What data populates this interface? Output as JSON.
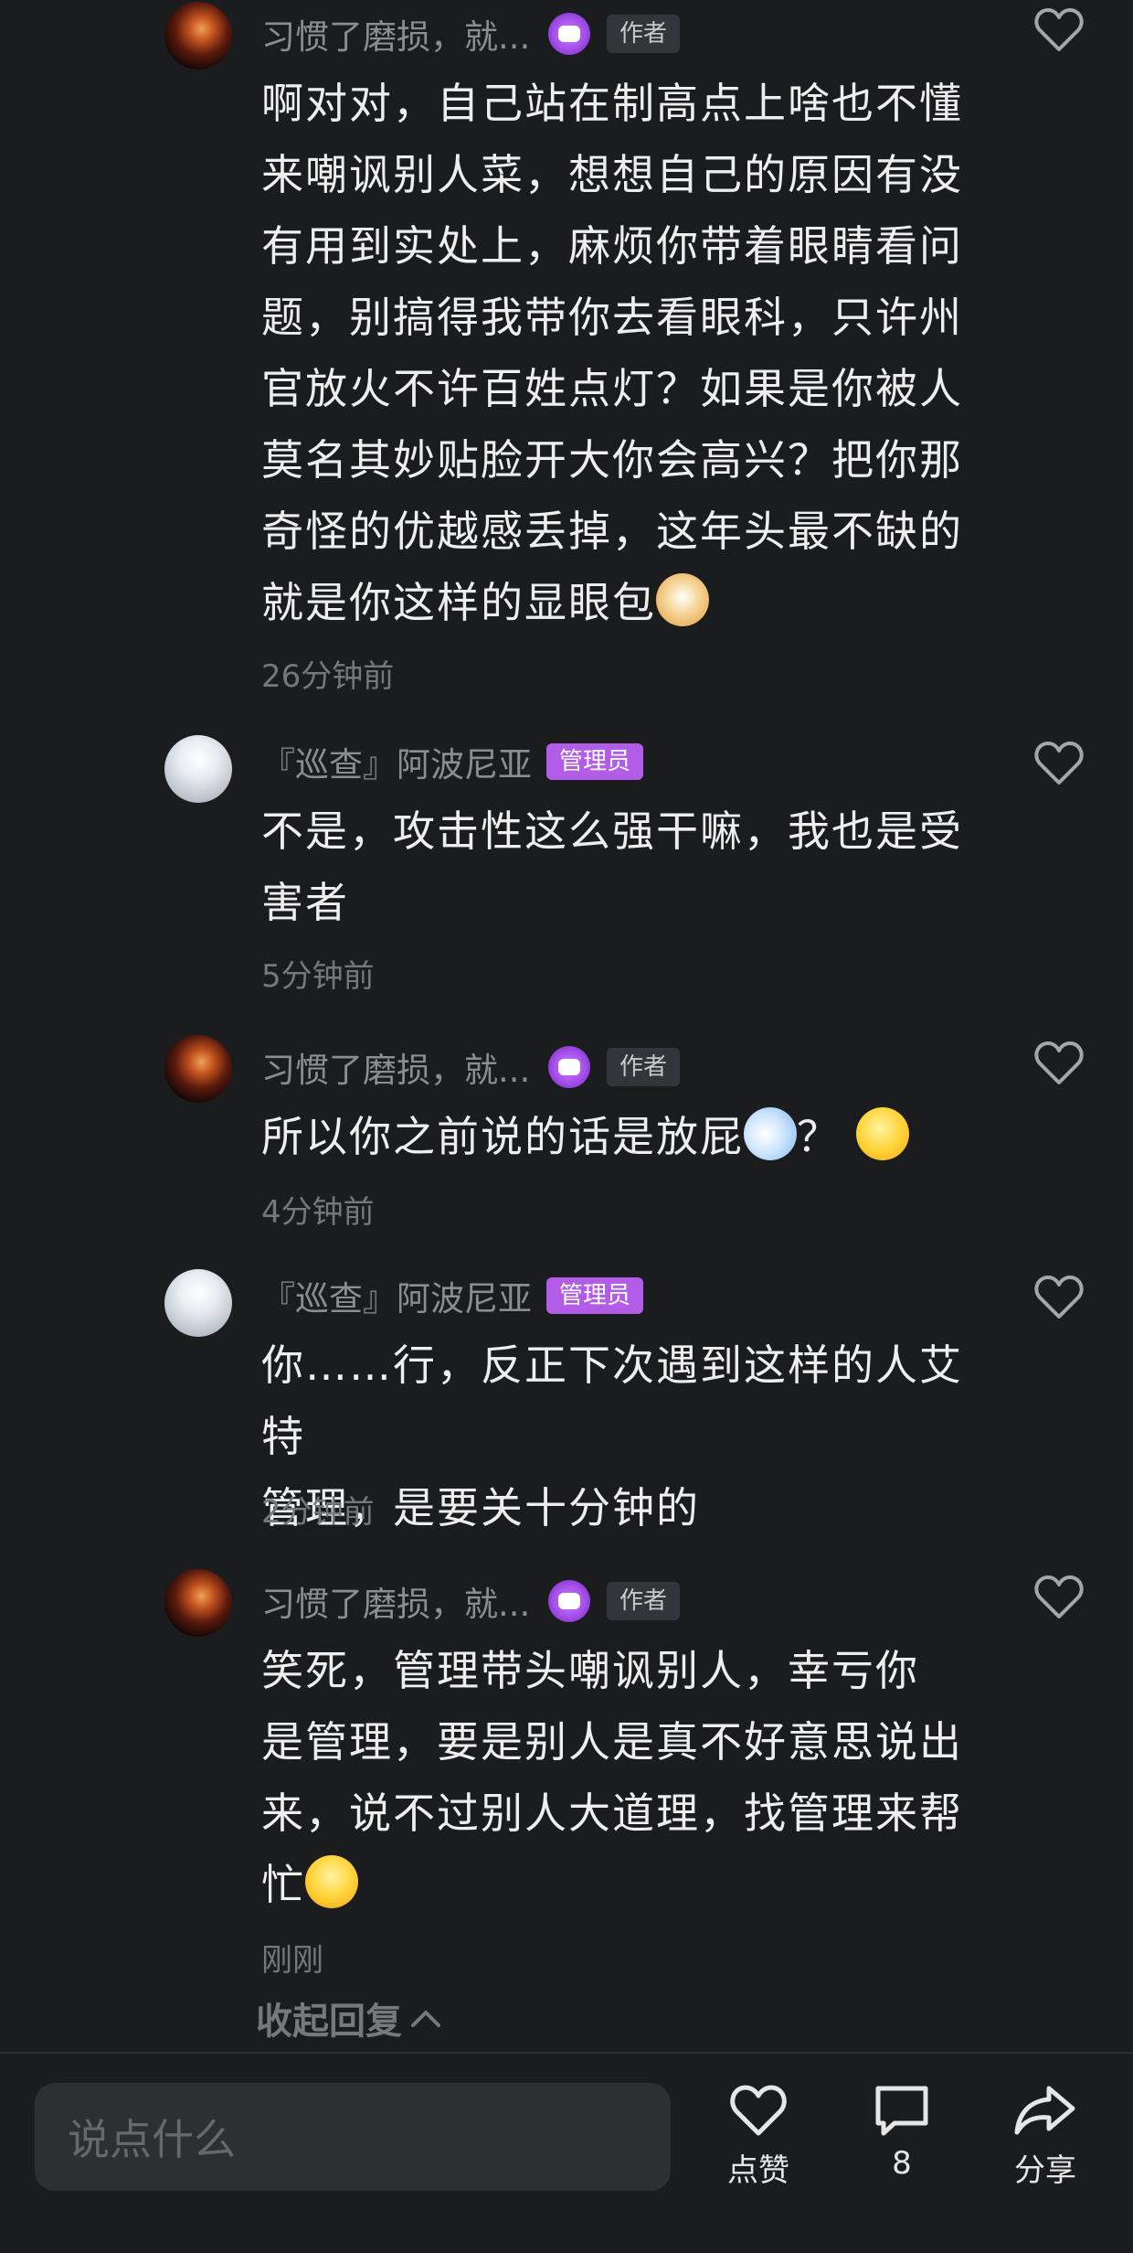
{
  "comments": [
    {
      "user": "习惯了磨损，就...",
      "role_tag": "作者",
      "text": "啊对对，自己站在制高点上啥也不懂\n来嘲讽别人菜，想想自己的原因有没\n有用到实处上，麻烦你带着眼睛看问\n题，别搞得我带你去看眼科，只许州\n官放火不许百姓点灯？如果是你被人\n莫名其妙贴脸开大你会高兴？把你那\n奇怪的优越感丢掉，这年头最不缺的\n就是你这样的显眼包",
      "emoji": "dog-face-emoji",
      "time": "26分钟前"
    },
    {
      "user": "『巡查』阿波尼亚",
      "role_tag": "管理员",
      "text": "不是，攻击性这么强干嘛，我也是受\n害者",
      "time": "5分钟前"
    },
    {
      "user": "习惯了磨损，就...",
      "role_tag": "作者",
      "text": "所以你之前说的话是放屁",
      "text_after": "？",
      "emoji": "dash-emoji",
      "emoji2": "thinking-face-emoji",
      "time": "4分钟前"
    },
    {
      "user": "『巡查』阿波尼亚",
      "role_tag": "管理员",
      "text": "你……行，反正下次遇到这样的人艾特\n管理，是要关十分钟的",
      "time": "2分钟前"
    },
    {
      "user": "习惯了磨损，就...",
      "role_tag": "作者",
      "text": "笑死，管理带头嘲讽别人，幸亏你\n是管理，要是别人是真不好意思说出\n来，说不过别人大道理，找管理来帮\n忙",
      "emoji": "tears-of-joy-emoji",
      "time": "刚刚"
    }
  ],
  "collapse_label": "收起回复",
  "bottom_bar": {
    "input_placeholder": "说点什么",
    "like_label": "点赞",
    "comment_count": "8",
    "share_label": "分享"
  },
  "colors": {
    "background": "#1b1c1e",
    "admin_tag": "#b35ce8",
    "author_tag_bg": "#34353a"
  }
}
